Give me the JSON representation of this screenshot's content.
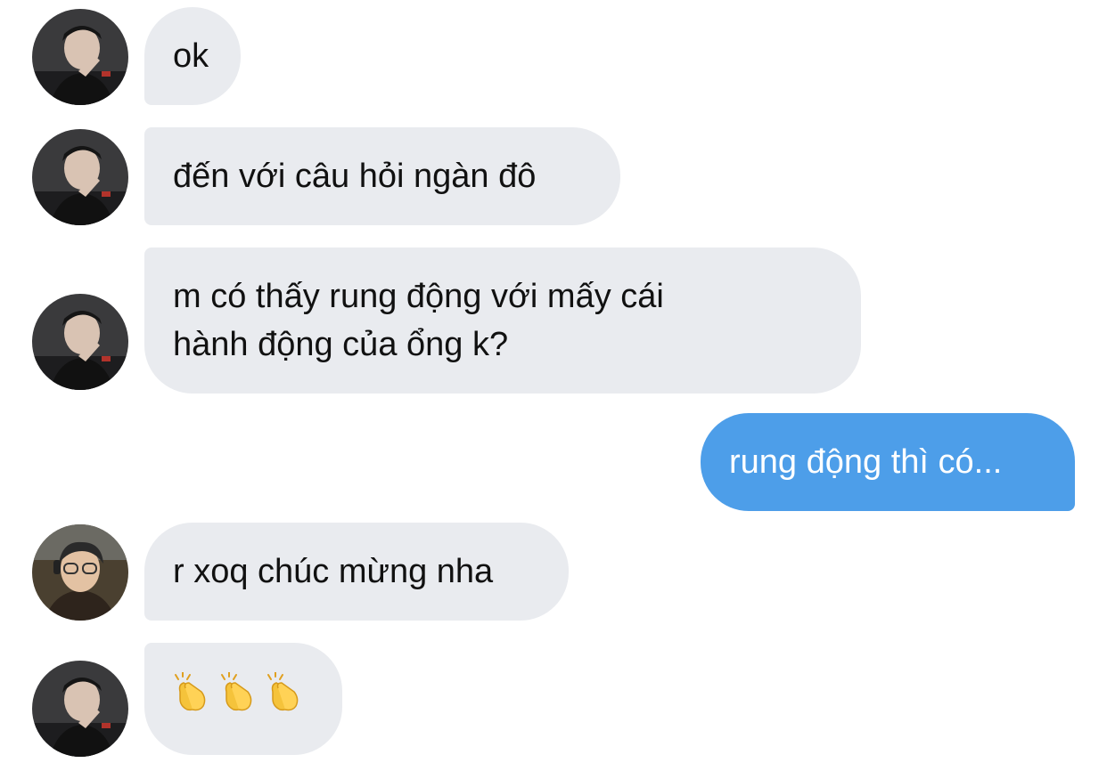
{
  "conversation": {
    "messages": [
      {
        "sender": "friend-1",
        "direction": "incoming",
        "lines": [
          "ok"
        ]
      },
      {
        "sender": "friend-1",
        "direction": "incoming",
        "lines": [
          "đến với câu hỏi ngàn đô"
        ]
      },
      {
        "sender": "friend-1",
        "direction": "incoming",
        "lines": [
          "m có thấy rung động với mấy cái",
          "hành động của ổng k?"
        ]
      },
      {
        "sender": "me",
        "direction": "outgoing",
        "lines": [
          "rung động thì có..."
        ]
      },
      {
        "sender": "friend-2",
        "direction": "incoming",
        "lines": [
          "r xoq chúc mừng nha"
        ]
      },
      {
        "sender": "friend-1",
        "direction": "incoming",
        "emoji": [
          "clapping-hands",
          "clapping-hands",
          "clapping-hands"
        ]
      }
    ]
  },
  "colors": {
    "incoming_bubble": "#e9ebef",
    "outgoing_bubble": "#4d9ee9",
    "incoming_text": "#111111",
    "outgoing_text": "#ffffff"
  }
}
